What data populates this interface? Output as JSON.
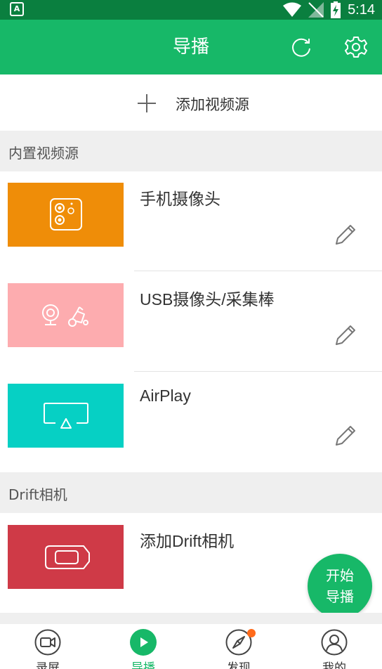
{
  "status_bar": {
    "time": "5:14"
  },
  "header": {
    "title": "导播"
  },
  "add_source": {
    "label": "添加视频源"
  },
  "sections": {
    "builtin": "内置视频源",
    "drift": "Drift相机"
  },
  "sources": [
    {
      "title": "手机摄像头",
      "color": "#ef8d08",
      "icon": "phone-camera-icon"
    },
    {
      "title": "USB摄像头/采集棒",
      "color": "#fdacaf",
      "icon": "usb-camera-icon"
    },
    {
      "title": "AirPlay",
      "color": "#06d0c4",
      "icon": "airplay-icon"
    }
  ],
  "drift_source": {
    "title": "添加Drift相机",
    "color": "#cf3a47",
    "icon": "drift-camera-icon"
  },
  "fab": {
    "line1": "开始",
    "line2": "导播"
  },
  "bottom_nav": [
    {
      "label": "录屏",
      "icon": "screen-record-icon",
      "active": false
    },
    {
      "label": "导播",
      "icon": "play-icon",
      "active": true
    },
    {
      "label": "发现",
      "icon": "compass-icon",
      "active": false,
      "badge": true
    },
    {
      "label": "我的",
      "icon": "profile-icon",
      "active": false
    }
  ],
  "colors": {
    "primary": "#17b868",
    "status_bar": "#0a7f3f",
    "badge": "#ff6a1a"
  }
}
